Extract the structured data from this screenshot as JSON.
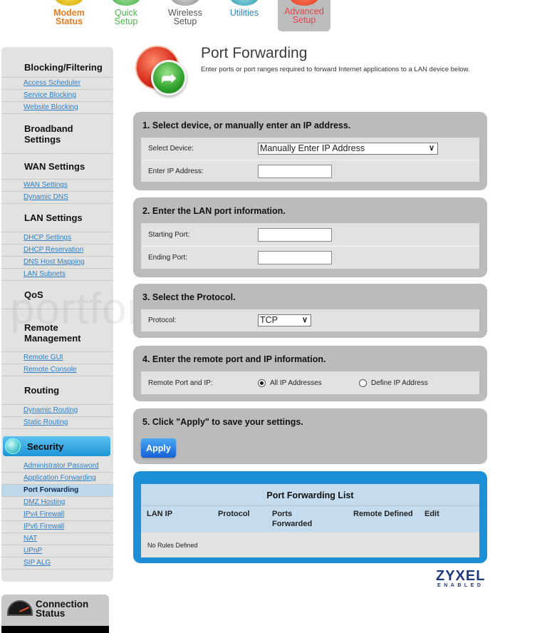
{
  "topnav": {
    "items": [
      {
        "label_line1": "Modem",
        "label_line2": "Status",
        "icon": "modem-status-icon"
      },
      {
        "label_line1": "Quick",
        "label_line2": "Setup",
        "icon": "quick-setup-icon"
      },
      {
        "label_line1": "Wireless",
        "label_line2": "Setup",
        "icon": "wireless-setup-icon"
      },
      {
        "label_line1": "Utilities",
        "label_line2": "",
        "icon": "utilities-icon"
      },
      {
        "label_line1": "Advanced",
        "label_line2": "Setup",
        "icon": "advanced-setup-icon",
        "active": true
      }
    ]
  },
  "sidebar": {
    "sections": [
      {
        "heading": "Blocking/Filtering",
        "links": [
          "Access Scheduler",
          "Service Blocking",
          "Website Blocking"
        ]
      },
      {
        "heading_line1": "Broadband",
        "heading_line2": "Settings",
        "links": []
      },
      {
        "heading": "WAN Settings",
        "links": [
          "WAN Settings",
          "Dynamic DNS"
        ]
      },
      {
        "heading": "LAN Settings",
        "links": [
          "DHCP Settings",
          "DHCP Reservation",
          "DNS Host Mapping",
          "LAN Subnets"
        ]
      },
      {
        "heading": "QoS",
        "links": []
      },
      {
        "heading_line1": "Remote",
        "heading_line2": "Management",
        "links": [
          "Remote GUI",
          "Remote Console"
        ]
      },
      {
        "heading": "Routing",
        "links": [
          "Dynamic Routing",
          "Static Routing"
        ]
      },
      {
        "heading": "Security",
        "active": true,
        "links": [
          "Administrator Password",
          "Application Forwarding",
          "Port Forwarding",
          "DMZ Hosting",
          "IPv4 Firewall",
          "IPv6 Firewall",
          "NAT",
          "UPnP",
          "SIP ALG"
        ],
        "active_link": "Port Forwarding"
      }
    ],
    "connection_status": {
      "line1": "Connection",
      "line2": "Status"
    }
  },
  "header": {
    "title": "Port Forwarding",
    "description": "Enter ports or port ranges required to forward Internet applications to a LAN device below."
  },
  "step1": {
    "title": "1. Select device, or manually enter an IP address.",
    "select_device_label": "Select Device:",
    "select_device_value": "Manually Enter IP Address",
    "ip_label": "Enter IP Address:",
    "ip_value": ""
  },
  "step2": {
    "title": "2. Enter the LAN port information.",
    "start_label": "Starting Port:",
    "start_value": "",
    "end_label": "Ending Port:",
    "end_value": ""
  },
  "step3": {
    "title": "3. Select the Protocol.",
    "protocol_label": "Protocol:",
    "protocol_value": "TCP"
  },
  "step4": {
    "title": "4. Enter the remote port and IP information.",
    "label": "Remote Port and IP:",
    "options": [
      {
        "label": "All IP Addresses",
        "selected": true
      },
      {
        "label": "Define IP Address",
        "selected": false
      }
    ]
  },
  "step5": {
    "title": "5. Click \"Apply\" to save your settings.",
    "apply_label": "Apply"
  },
  "list": {
    "title": "Port Forwarding List",
    "columns": [
      "LAN IP",
      "Protocol",
      "Ports Forwarded",
      "Remote Defined",
      "Edit"
    ],
    "empty_text": "No Rules Defined"
  },
  "branding": {
    "brand": "ZYXEL",
    "tagline": "ENABLED",
    "watermark": "portforward"
  },
  "colors": {
    "accent_blue": "#1d8fd6",
    "panel_gray": "#bbbbbb",
    "link_blue": "#2f7fc8",
    "active_nav": "#e0474c"
  }
}
